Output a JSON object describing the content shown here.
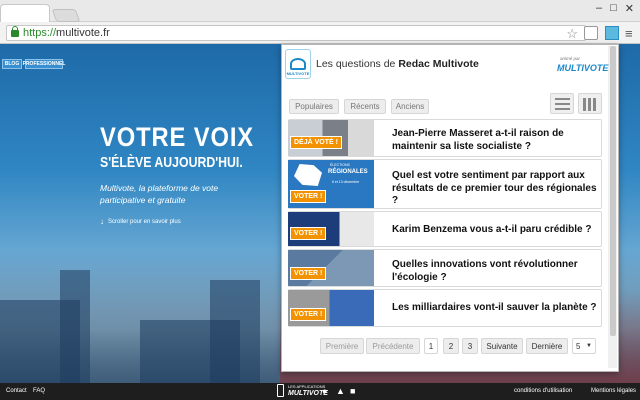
{
  "browser": {
    "url_scheme": "https://",
    "url_host": "multivote.fr",
    "window_controls": [
      "–",
      "□",
      "✕"
    ]
  },
  "site": {
    "top_buttons": [
      "BLOG",
      "PROFESSIONNEL"
    ],
    "hero_title": "VOTRE VOIX",
    "hero_subtitle": "S'ÉLÈVE AUJOURD'HUI.",
    "hero_text": "Multivote, la plateforme de vote participative et gratuite",
    "scroll_hint": "Scroller pour en savoir plus",
    "footer_left": [
      "Contact",
      "FAQ"
    ],
    "footer_app": "LES APPLICATIONS",
    "footer_brand": "MULTIVOTE",
    "footer_right": [
      "conditions d'utilisation",
      "Mentions légales"
    ]
  },
  "popup": {
    "logo_text": "MULTIVOTE",
    "title_prefix": "Les questions de ",
    "title_author": "Redac Multivote",
    "animated_by": "animé par",
    "brand": "MULTIVOTE",
    "filters": [
      "Populaires",
      "Récents",
      "Anciens"
    ],
    "questions": [
      {
        "text": "Jean-Pierre Masseret a-t-il raison de maintenir sa liste socialiste ?",
        "badge": "DÉJÀ VOTÉ !"
      },
      {
        "text": "Quel est votre sentiment par rapport aux résultats de ce premier tour des régionales ?",
        "badge": "VOTER !",
        "thumb_title": "ÉLECTIONS",
        "thumb_big": "RÉGIONALES",
        "thumb_date": "6 et 13 décembre"
      },
      {
        "text": "Karim Benzema vous a-t-il paru crédible ?",
        "badge": "VOTER !"
      },
      {
        "text": "Quelles innovations vont révolutionner l'écologie ?",
        "badge": "VOTER !"
      },
      {
        "text": "Les milliardaires vont-il sauver la planète ?",
        "badge": "VOTER !"
      }
    ],
    "pagination": {
      "first": "Première",
      "prev": "Précédente",
      "pages": [
        "1",
        "2",
        "3"
      ],
      "next": "Suivante",
      "last": "Dernière",
      "per_page": "5"
    }
  },
  "colors": {
    "accent": "#1a88c9",
    "badge": "#f39200"
  }
}
